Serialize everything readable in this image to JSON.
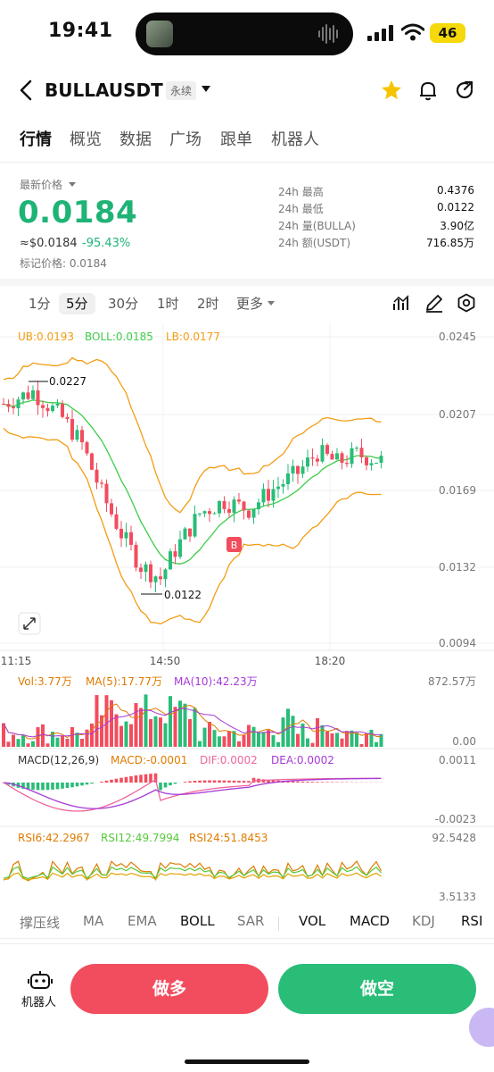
{
  "status_bar": {
    "time": "19:41",
    "battery": "46"
  },
  "header": {
    "symbol": "BULLAUSDT",
    "contract_type": "永续"
  },
  "tabs": [
    {
      "label": "行情",
      "active": true
    },
    {
      "label": "概览"
    },
    {
      "label": "数据"
    },
    {
      "label": "广场"
    },
    {
      "label": "跟单"
    },
    {
      "label": "机器人"
    }
  ],
  "price": {
    "label": "最新价格",
    "last": "0.0184",
    "usd": "≈$0.0184",
    "change": "-95.43%",
    "mark": "标记价格: 0.0184"
  },
  "stats": [
    {
      "label": "24h  最高",
      "value": "0.4376"
    },
    {
      "label": "24h  最低",
      "value": "0.0122"
    },
    {
      "label": "24h  量(BULLA)",
      "value": "3.90亿"
    },
    {
      "label": "24h  额(USDT)",
      "value": "716.85万"
    }
  ],
  "intervals": [
    {
      "label": "1分"
    },
    {
      "label": "5分",
      "active": true
    },
    {
      "label": "30分"
    },
    {
      "label": "1时"
    },
    {
      "label": "2时"
    },
    {
      "label": "更多"
    }
  ],
  "chart_data": {
    "type": "candlestick",
    "boll": {
      "ub": "UB:0.0193",
      "boll": "BOLL:0.0185",
      "lb": "LB:0.0177"
    },
    "y_ticks": [
      "0.0245",
      "0.0207",
      "0.0169",
      "0.0132",
      "0.0094"
    ],
    "x_ticks": [
      "11:15",
      "14:50",
      "18:20"
    ],
    "high_marker": "0.0227",
    "low_marker": "0.0122",
    "buy_marker": "B",
    "volume": {
      "vol": "Vol:3.77万",
      "ma5": "MA(5):17.77万",
      "ma10": "MA(10):42.23万",
      "max": "872.57万",
      "zero": "0.00"
    },
    "macd": {
      "label": "MACD(12,26,9)",
      "macd": "MACD:-0.0001",
      "dif": "DIF:0.0002",
      "dea": "DEA:0.0002",
      "max": "0.0011",
      "min": "-0.0023"
    },
    "rsi": {
      "rsi6": "RSI6:42.2967",
      "rsi12": "RSI12:49.7994",
      "rsi24": "RSI24:51.8453",
      "max": "92.5428",
      "min": "3.5133"
    },
    "colors": {
      "up": "#f24d5e",
      "down": "#29bd78",
      "ub": "#f39c12",
      "mid": "#3ecc4a",
      "macd_dif": "#f0669d",
      "macd_dea": "#a63ad8"
    }
  },
  "indicators": [
    {
      "label": "撑压线"
    },
    {
      "label": "MA"
    },
    {
      "label": "EMA"
    },
    {
      "label": "BOLL",
      "on": true
    },
    {
      "label": "SAR"
    },
    {
      "label": "VOL",
      "on": true
    },
    {
      "label": "MACD",
      "on": true
    },
    {
      "label": "KDJ"
    },
    {
      "label": "RSI",
      "on": true
    }
  ],
  "bottom": {
    "robot_label": "机器人",
    "long": "做多",
    "short": "做空"
  }
}
